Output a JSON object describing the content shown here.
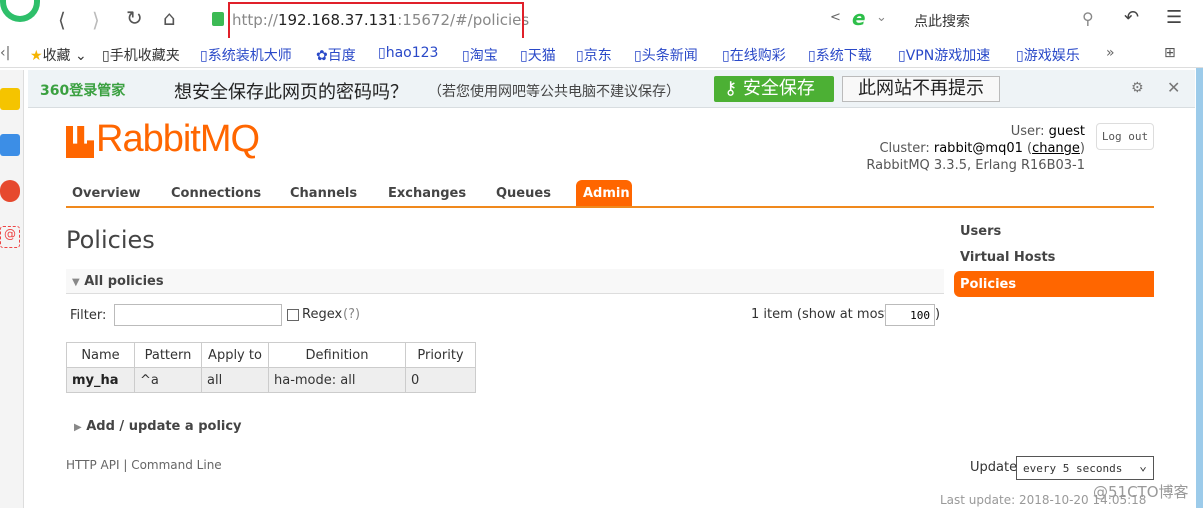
{
  "browser": {
    "url_prefix": "http://",
    "url_host": "192.168.37.131",
    "url_rest": ":15672/#/policies",
    "search_placeholder": "点此搜索"
  },
  "bookmarks": [
    "收藏",
    "手机收藏夹",
    "系统装机大师",
    "百度",
    "hao123",
    "淘宝",
    "天猫",
    "京东",
    "头条新闻",
    "在线购彩",
    "系统下载",
    "VPN游戏加速",
    "游戏娱乐"
  ],
  "pwbar": {
    "brand": "360登录管家",
    "question": "想安全保存此网页的密码吗？",
    "note": "（若您使用网吧等公共电脑不建议保存）",
    "save": "安全保存",
    "never": "此网站不再提示"
  },
  "header": {
    "logo": "RabbitMQ",
    "user_label": "User:",
    "user": "guest",
    "cluster_label": "Cluster:",
    "cluster": "rabbit@mq01",
    "change": "change",
    "version": "RabbitMQ 3.3.5, Erlang R16B03-1",
    "logout": "Log out"
  },
  "nav": [
    "Overview",
    "Connections",
    "Channels",
    "Exchanges",
    "Queues",
    "Admin"
  ],
  "side": [
    "Users",
    "Virtual Hosts",
    "Policies"
  ],
  "main": {
    "title": "Policies",
    "section": "All policies",
    "filter_label": "Filter:",
    "regex": "Regex",
    "regex_help": "(?)",
    "count": "1 item (show at most",
    "max": "100",
    "count_end": ")",
    "columns": [
      "Name",
      "Pattern",
      "Apply to",
      "Definition",
      "Priority"
    ],
    "rows": [
      [
        "my_ha",
        "^a",
        "all",
        "ha-mode: all",
        "0"
      ]
    ],
    "add": "Add / update a policy"
  },
  "footer": {
    "http_api": "HTTP API",
    "cmdline": "Command Line",
    "update_label": "Update",
    "update_value": "every 5 seconds",
    "last_update": "Last update: 2018-10-20 14:05:18",
    "watermark": "@51CTO博客"
  },
  "colors": {
    "accent": "#ff6600",
    "nav_line": "#f0891d",
    "green": "#4cb034"
  }
}
